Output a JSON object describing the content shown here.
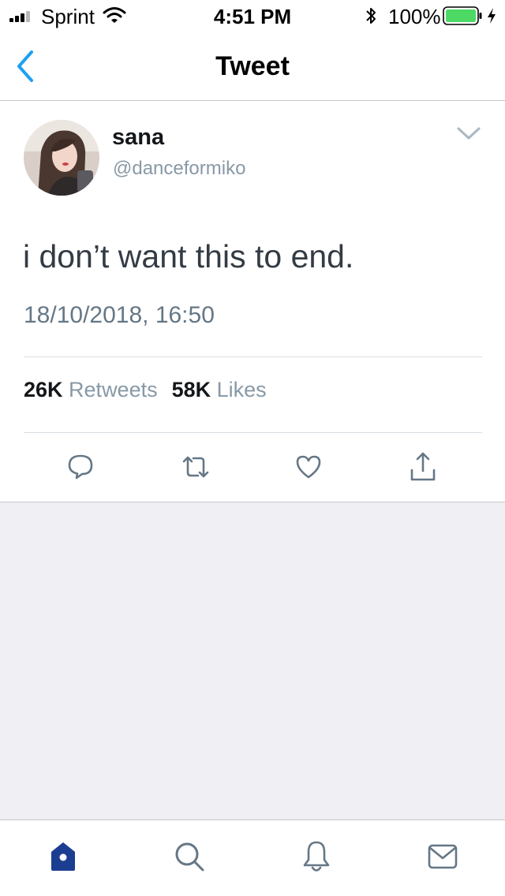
{
  "status_bar": {
    "carrier": "Sprint",
    "time": "4:51 PM",
    "battery_percent": "100%",
    "signal_strength": 0.75,
    "battery_level": 1.0,
    "icons": [
      "signal-icon",
      "wifi-icon",
      "bluetooth-icon",
      "battery-icon",
      "charging-icon"
    ]
  },
  "nav": {
    "title": "Tweet",
    "back_icon": "chevron-left-icon"
  },
  "tweet": {
    "display_name": "sana",
    "handle": "@danceformiko",
    "text": "i don’t want this to end.",
    "timestamp": "18/10/2018, 16:50",
    "retweets_count": "26K",
    "retweets_label": "Retweets",
    "likes_count": "58K",
    "likes_label": "Likes",
    "menu_icon": "chevron-down-icon"
  },
  "actions": [
    {
      "icon": "reply-icon"
    },
    {
      "icon": "retweet-icon"
    },
    {
      "icon": "like-icon"
    },
    {
      "icon": "share-icon"
    }
  ],
  "tab_bar": {
    "tabs": [
      {
        "icon": "home-icon",
        "active": true
      },
      {
        "icon": "search-icon",
        "active": false
      },
      {
        "icon": "notifications-icon",
        "active": false
      },
      {
        "icon": "messages-icon",
        "active": false
      }
    ]
  },
  "colors": {
    "accent": "#1da1f2",
    "active_tab": "#1c3e91",
    "icon_gray": "#657786",
    "secondary_text": "#8899a6",
    "battery_green": "#4cd964",
    "background_gray": "#efeff4"
  }
}
